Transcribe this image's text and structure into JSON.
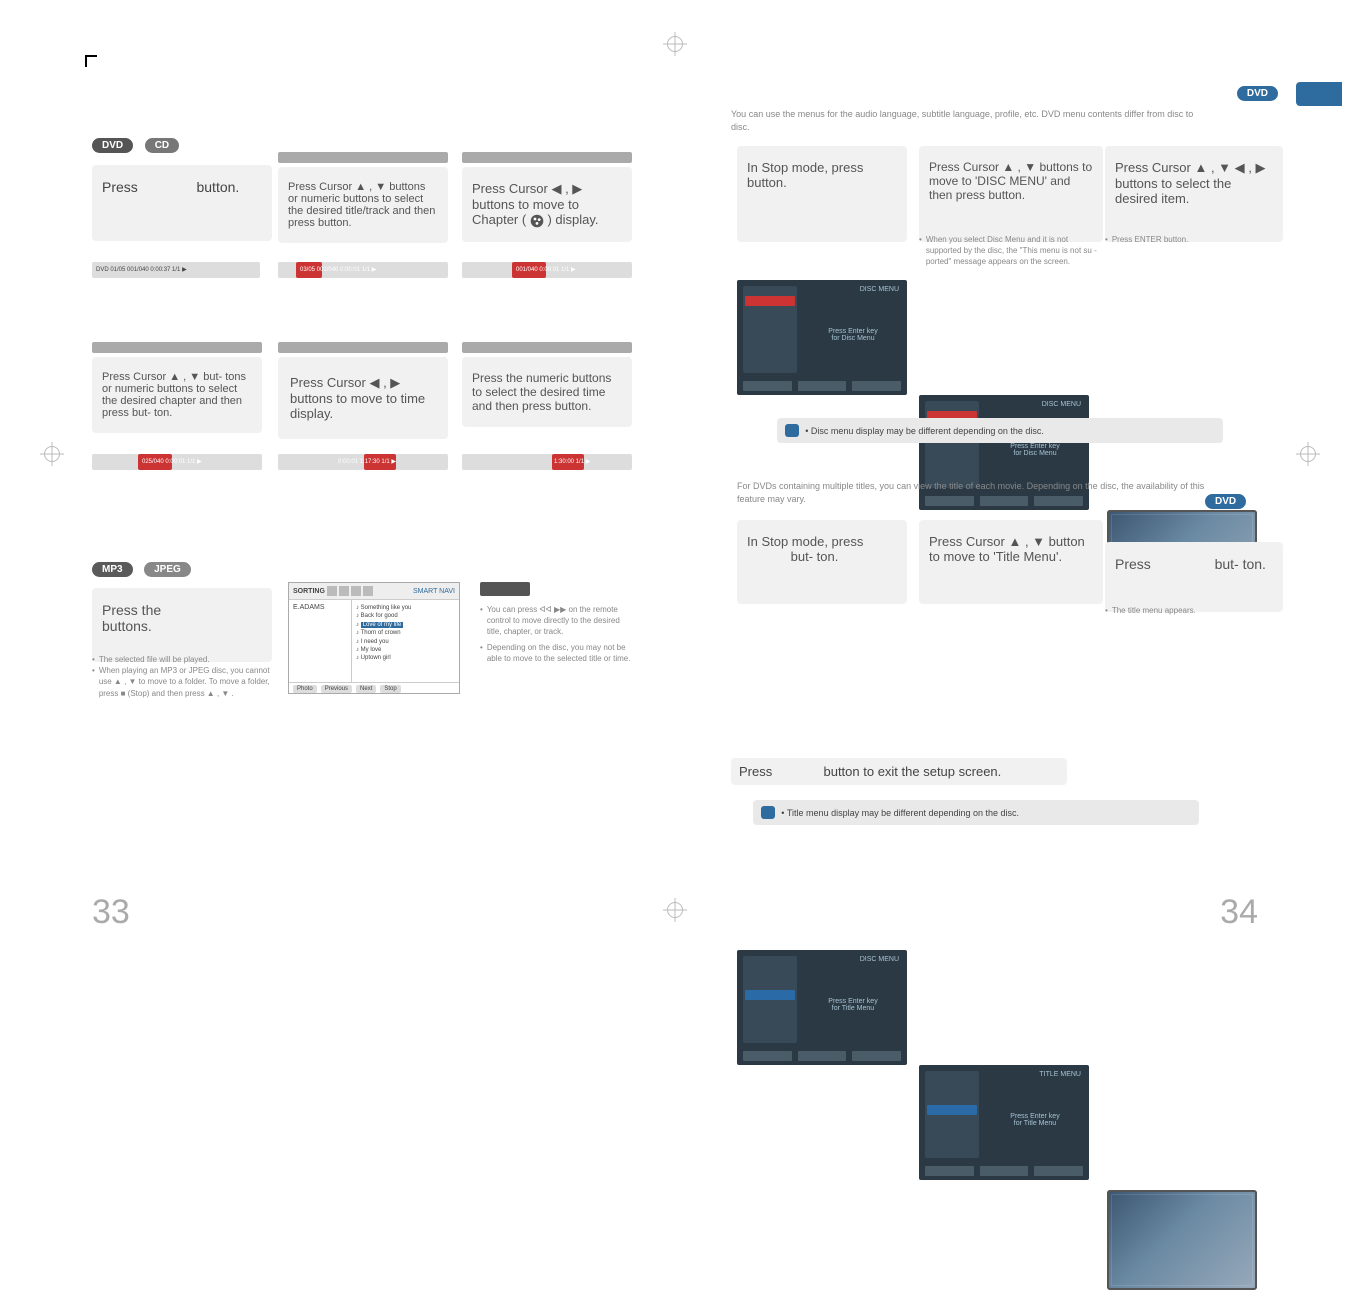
{
  "pageNumbers": {
    "left": "33",
    "right": "34"
  },
  "pills": {
    "dvd": "DVD",
    "cd": "CD",
    "mp3": "MP3",
    "jpeg": "JPEG"
  },
  "leftPage": {
    "step1": {
      "pre": "Press",
      "post": "button."
    },
    "step2": "Press Cursor ▲ , ▼ buttons or numeric buttons to select the desired title/track and then press            button.",
    "step3_pre": "Press Cursor ◀ , ▶ buttons to move to Chapter (",
    "step3_post": ") display.",
    "step4": "Press Cursor ▲ , ▼ but- tons or numeric buttons to select the desired chapter and then press            but- ton.",
    "step5": "Press Cursor ◀ , ▶ buttons to move to time display.",
    "step6": "Press the numeric buttons to select the desired time and then press               button.",
    "mp3header_pre": "Press the",
    "mp3header_post": "buttons.",
    "mp3notes": [
      "The selected file will be played.",
      "When playing an MP3 or JPEG disc, you cannot use ▲ , ▼ to move to a folder. To move a folder, press ■ (Stop) and then press ▲ , ▼ ."
    ],
    "remote_notes": [
      "You can press ᐊᐊ ▶▶ on the remote control to move directly to the desired title, chapter, or track.",
      "Depending on the disc, you may not be able to move to the selected title or time."
    ],
    "strip1": "DVD   01/05   001/040   0:00:37   1/1  ▶",
    "strip2": "03/05   001/040   0:00:01   1/1  ▶",
    "strip3": "001/040   0:00:01   1/1  ▶",
    "strip4": "025/040   0:00:01   1/1  ▶",
    "strip5": "0:00:01   1:17:30   1/1  ▶",
    "strip6": "1:30:00   1/1  ▶",
    "browser": {
      "sortingLabel": "SORTING",
      "navLabel": "SMART NAVI",
      "artist": "E.ADAMS",
      "songs": [
        "Something like you",
        "Back for good",
        "Love of my life",
        "Thorn of crown",
        "I need you",
        "My love",
        "Uptown girl"
      ],
      "hlIndex": 2,
      "btns": [
        "Photo",
        "Previous",
        "Next",
        "Stop"
      ]
    }
  },
  "rightPage": {
    "intro": "You can use the menus for the audio language, subtitle language, profile, etc. DVD menu contents differ from disc to disc.",
    "step1": {
      "pre": "In Stop mode, press",
      "post": "button."
    },
    "step2": "Press Cursor ▲ , ▼ buttons to move to 'DISC MENU' and then press            button.",
    "step2b": "When you select Disc Menu and it is not supported by the disc, the \"This menu is not su - ported\" message appears on the screen.",
    "step3": "Press Cursor ▲ , ▼ ◀ , ▶ buttons to select the desired item.",
    "step3b": "Press ENTER button.",
    "osd1": {
      "title": "DISC MENU",
      "center1": "Press Enter key",
      "center2": "for Disc Menu",
      "hlTop": 16
    },
    "osd2": {
      "title": "DISC MENU",
      "center1": "Press Enter key",
      "center2": "for Disc Menu",
      "hlTop": 16
    },
    "notice1": "Disc menu display may be different depending on the disc.",
    "titleIntro": "For DVDs containing multiple titles, you can view the title of each movie. Depending on the disc, the availability of this feature may vary.",
    "t_step1": {
      "pre": "In Stop mode, press",
      "post": "but- ton."
    },
    "t_step2": "Press Cursor ▲ , ▼ button to move to 'Title Menu'.",
    "t_step3": {
      "pre": "Press",
      "post": "but- ton."
    },
    "t_step3b": "The title menu appears.",
    "osd3": {
      "title": "DISC MENU",
      "center1": "Press Enter key",
      "center2": "for Title Menu",
      "hlTop": 40
    },
    "osd4": {
      "title": "TITLE MENU",
      "center1": "Press Enter key",
      "center2": "for Title Menu",
      "hlTop": 40
    },
    "exit": {
      "pre": "Press",
      "post": "button to exit the setup screen."
    },
    "notice2": "Title menu display may be different depending on the disc."
  }
}
